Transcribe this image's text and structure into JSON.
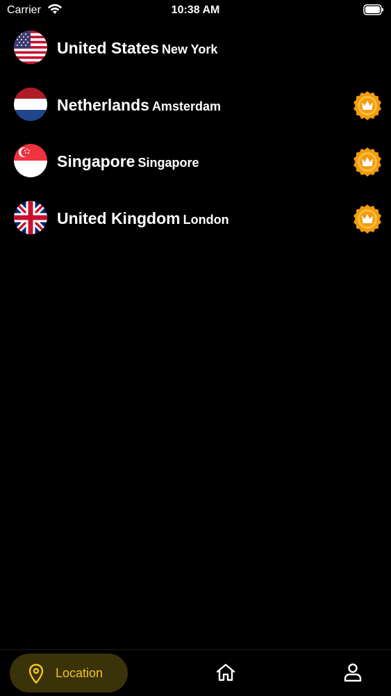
{
  "status_bar": {
    "carrier": "Carrier",
    "time": "10:38 AM"
  },
  "servers": [
    {
      "country": "United States",
      "city": "New York",
      "flag": "us-flag-icon",
      "premium": false
    },
    {
      "country": "Netherlands",
      "city": "Amsterdam",
      "flag": "nl-flag-icon",
      "premium": true
    },
    {
      "country": "Singapore",
      "city": "Singapore",
      "flag": "sg-flag-icon",
      "premium": true
    },
    {
      "country": "United Kingdom",
      "city": "London",
      "flag": "uk-flag-icon",
      "premium": true
    }
  ],
  "tab_bar": {
    "location_label": "Location",
    "active_tab": "location",
    "accent_color": "#f2c522",
    "icons": [
      "location-pin-icon",
      "home-icon",
      "profile-icon"
    ]
  }
}
